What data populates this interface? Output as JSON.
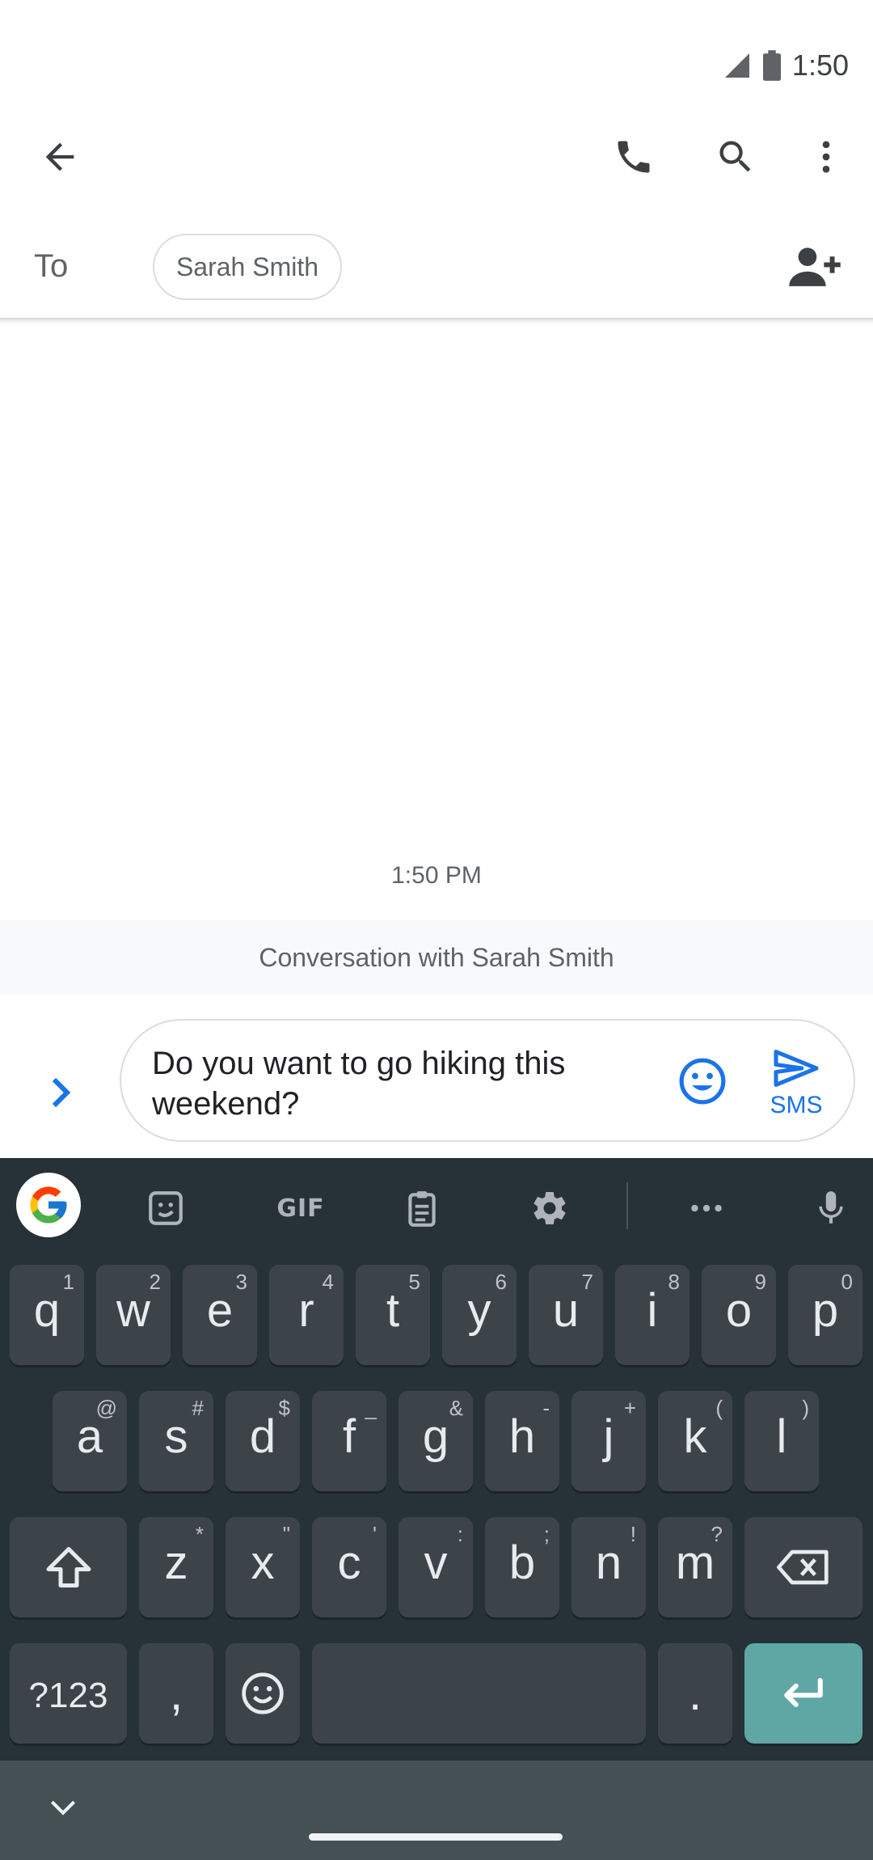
{
  "status_bar": {
    "time": "1:50"
  },
  "app_bar": {
    "back": "back-arrow-icon",
    "actions": [
      "phone-icon",
      "search-icon",
      "more-vert-icon"
    ]
  },
  "recipients": {
    "to_label": "To",
    "chips": [
      "Sarah Smith"
    ]
  },
  "conversation": {
    "timestamp": "1:50 PM",
    "banner": "Conversation with Sarah Smith"
  },
  "compose": {
    "text": "Do you want to go hiking this weekend?",
    "send_label": "SMS"
  },
  "keyboard": {
    "toolbar": {
      "gif_label": "GIF",
      "tools": [
        "google-icon",
        "sticker-icon",
        "gif-icon",
        "clipboard-icon",
        "settings-icon",
        "more-horiz-icon",
        "mic-icon"
      ]
    },
    "row1": [
      {
        "key": "q",
        "hint": "1"
      },
      {
        "key": "w",
        "hint": "2"
      },
      {
        "key": "e",
        "hint": "3"
      },
      {
        "key": "r",
        "hint": "4"
      },
      {
        "key": "t",
        "hint": "5"
      },
      {
        "key": "y",
        "hint": "6"
      },
      {
        "key": "u",
        "hint": "7"
      },
      {
        "key": "i",
        "hint": "8"
      },
      {
        "key": "o",
        "hint": "9"
      },
      {
        "key": "p",
        "hint": "0"
      }
    ],
    "row2": [
      {
        "key": "a",
        "hint": "@"
      },
      {
        "key": "s",
        "hint": "#"
      },
      {
        "key": "d",
        "hint": "$"
      },
      {
        "key": "f",
        "hint": "_"
      },
      {
        "key": "g",
        "hint": "&"
      },
      {
        "key": "h",
        "hint": "-"
      },
      {
        "key": "j",
        "hint": "+"
      },
      {
        "key": "k",
        "hint": "("
      },
      {
        "key": "l",
        "hint": ")"
      }
    ],
    "row3": [
      {
        "key": "z",
        "hint": "*"
      },
      {
        "key": "x",
        "hint": "\""
      },
      {
        "key": "c",
        "hint": "'"
      },
      {
        "key": "v",
        "hint": ":"
      },
      {
        "key": "b",
        "hint": ";"
      },
      {
        "key": "n",
        "hint": "!"
      },
      {
        "key": "m",
        "hint": "?"
      }
    ],
    "bottom": {
      "symbols": "?123",
      "comma": ",",
      "period": "."
    }
  },
  "colors": {
    "accent": "#1a73e8",
    "keyboard_bg": "#263238",
    "key_bg": "#3c4449",
    "enter_key": "#5fa7a4"
  }
}
